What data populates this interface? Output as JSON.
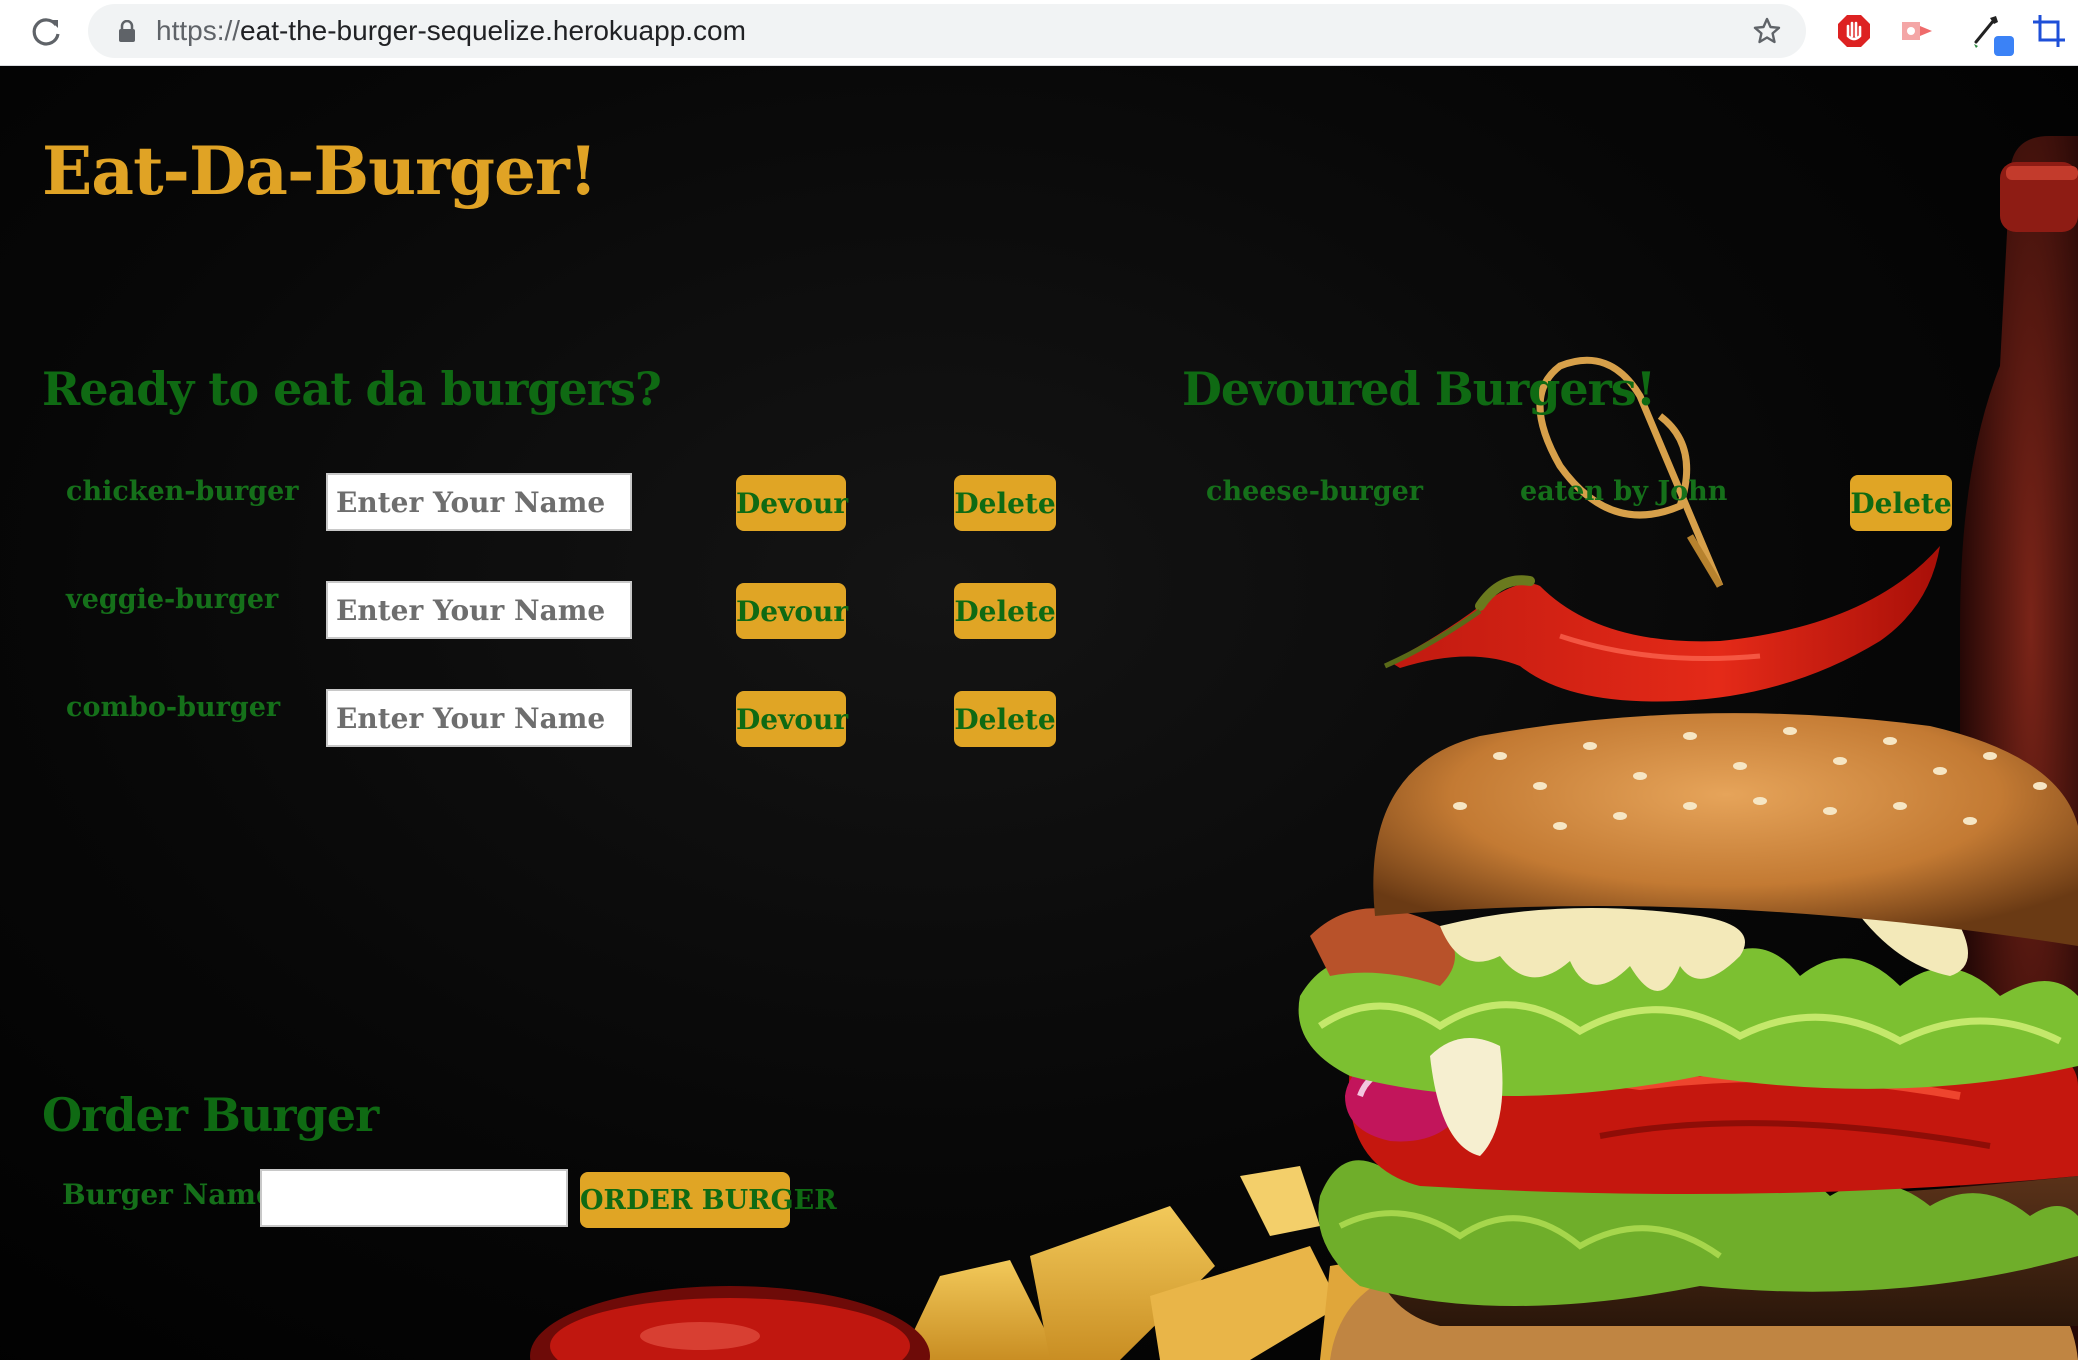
{
  "browser": {
    "url_scheme": "https://",
    "url_host": "eat-the-burger-sequelize.herokuapp.com"
  },
  "page": {
    "title": "Eat-Da-Burger!",
    "ready_heading": "Ready to eat da burgers?",
    "devoured_heading": "Devoured Burgers!",
    "ready_burgers": [
      {
        "name": "chicken-burger",
        "input_placeholder": "Enter Your Name",
        "devour_label": "Devour",
        "delete_label": "Delete"
      },
      {
        "name": "veggie-burger",
        "input_placeholder": "Enter Your Name",
        "devour_label": "Devour",
        "delete_label": "Delete"
      },
      {
        "name": "combo-burger",
        "input_placeholder": "Enter Your Name",
        "devour_label": "Devour",
        "delete_label": "Delete"
      }
    ],
    "devoured_burgers": [
      {
        "name": "cheese-burger",
        "eaten_by": "eaten by John",
        "delete_label": "Delete"
      }
    ],
    "order": {
      "heading": "Order Burger",
      "label": "Burger Name:",
      "input_value": "",
      "button_label": "ORDER BURGER"
    }
  },
  "colors": {
    "accent": "#e0a325",
    "heading_green": "#0f6a13",
    "background": "#000000"
  },
  "icons": [
    "reload-icon",
    "lock-icon",
    "bookmark-star-icon",
    "adblock-extension-icon",
    "cast-extension-icon",
    "color-picker-extension-icon",
    "crop-extension-icon"
  ]
}
